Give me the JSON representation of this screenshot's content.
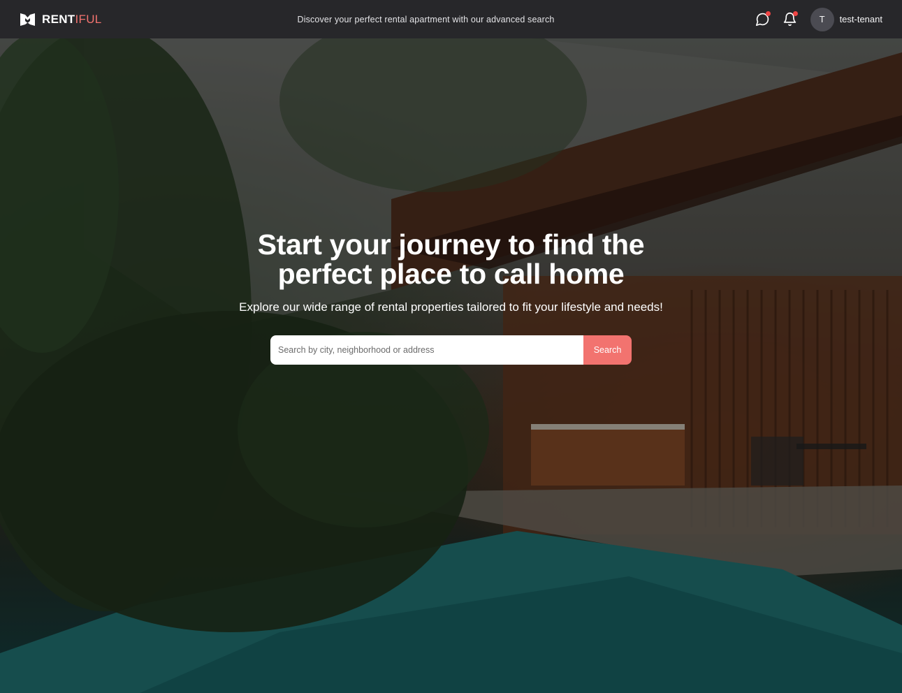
{
  "brand": {
    "name_primary": "RENT",
    "name_accent": "IFUL",
    "accent_color": "#f2736f"
  },
  "navbar": {
    "tagline": "Discover your perfect rental apartment with our advanced search",
    "messages_icon": "chat-bubble-icon",
    "notifications_icon": "bell-icon",
    "notification_dot_color": "#ef4444"
  },
  "user": {
    "avatar_initial": "T",
    "username": "test-tenant"
  },
  "hero": {
    "headline": "Start your journey to find the perfect place to call home",
    "subheadline": "Explore our wide range of rental properties tailored to fit your lifestyle and needs!",
    "search": {
      "placeholder": "Search by city, neighborhood or address",
      "value": "",
      "button_label": "Search"
    }
  }
}
